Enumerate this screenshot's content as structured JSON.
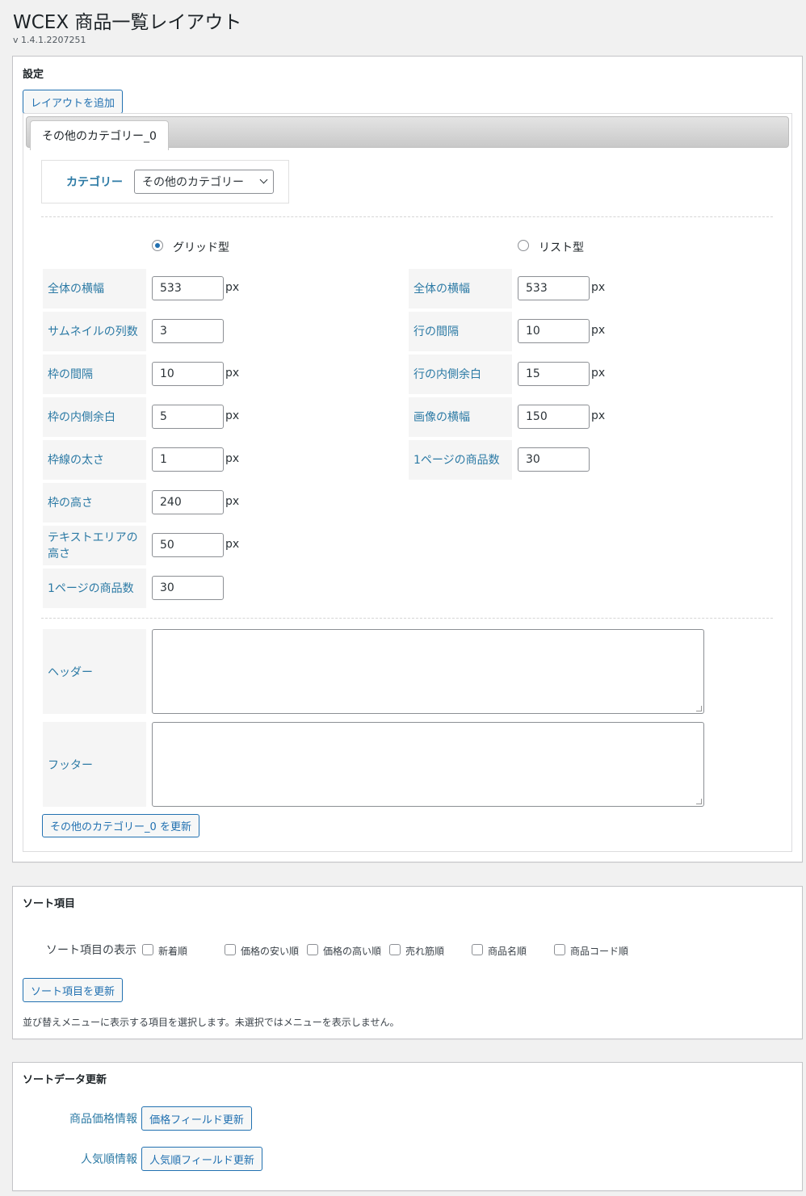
{
  "page": {
    "title": "WCEX 商品一覧レイアウト",
    "version": "v 1.4.1.2207251"
  },
  "settings": {
    "title": "設定",
    "add_layout_button": "レイアウトを追加",
    "tab_label": "その他のカテゴリー_0",
    "category_label": "カテゴリー",
    "category_value": "その他のカテゴリー",
    "grid_option": "グリッド型",
    "list_option": "リスト型",
    "selected_layout": "グリッド型",
    "grid_fields": [
      {
        "label": "全体の横幅",
        "value": "533",
        "unit": "px"
      },
      {
        "label": "サムネイルの列数",
        "value": "3",
        "unit": ""
      },
      {
        "label": "枠の間隔",
        "value": "10",
        "unit": "px"
      },
      {
        "label": "枠の内側余白",
        "value": "5",
        "unit": "px"
      },
      {
        "label": "枠線の太さ",
        "value": "1",
        "unit": "px"
      },
      {
        "label": "枠の高さ",
        "value": "240",
        "unit": "px"
      },
      {
        "label": "テキストエリアの高さ",
        "value": "50",
        "unit": "px"
      },
      {
        "label": "1ページの商品数",
        "value": "30",
        "unit": ""
      }
    ],
    "list_fields": [
      {
        "label": "全体の横幅",
        "value": "533",
        "unit": "px"
      },
      {
        "label": "行の間隔",
        "value": "10",
        "unit": "px"
      },
      {
        "label": "行の内側余白",
        "value": "15",
        "unit": "px"
      },
      {
        "label": "画像の横幅",
        "value": "150",
        "unit": "px"
      },
      {
        "label": "1ページの商品数",
        "value": "30",
        "unit": ""
      }
    ],
    "header_label": "ヘッダー",
    "footer_label": "フッター",
    "update_button": "その他のカテゴリー_0 を更新"
  },
  "sort_items": {
    "title": "ソート項目",
    "display_label": "ソート項目の表示",
    "options": [
      "新着順",
      "価格の安い順",
      "価格の高い順",
      "売れ筋順",
      "商品名順",
      "商品コード順"
    ],
    "update_button": "ソート項目を更新",
    "note": "並び替えメニューに表示する項目を選択します。未選択ではメニューを表示しません。"
  },
  "sort_data": {
    "title": "ソートデータ更新",
    "price_label": "商品価格情報",
    "price_button": "価格フィールド更新",
    "popular_label": "人気順情報",
    "popular_button": "人気順フィールド更新"
  }
}
